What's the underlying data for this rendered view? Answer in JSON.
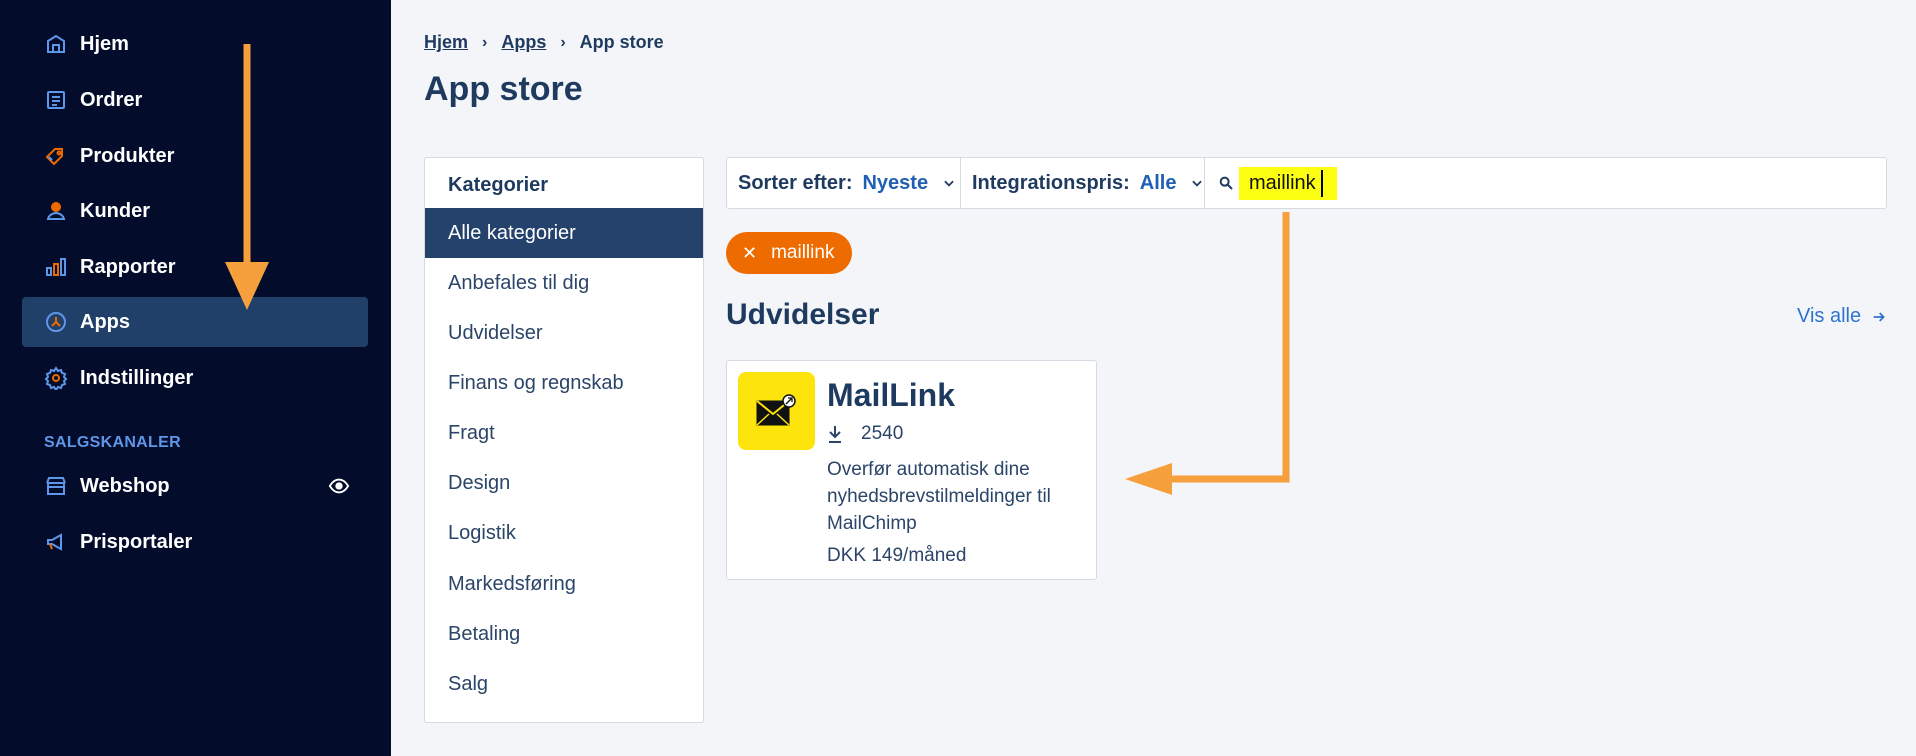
{
  "sidebar": {
    "items": [
      {
        "label": "Hjem",
        "icon": "home-icon"
      },
      {
        "label": "Ordrer",
        "icon": "orders-icon"
      },
      {
        "label": "Produkter",
        "icon": "tag-icon"
      },
      {
        "label": "Kunder",
        "icon": "user-icon"
      },
      {
        "label": "Rapporter",
        "icon": "bar-chart-icon"
      },
      {
        "label": "Apps",
        "icon": "apps-icon"
      },
      {
        "label": "Indstillinger",
        "icon": "gear-icon"
      }
    ],
    "active": "Apps",
    "sales_channels_title": "SALGSKANALER",
    "channels": [
      {
        "label": "Webshop",
        "icon": "store-icon"
      },
      {
        "label": "Prisportaler",
        "icon": "megaphone-icon"
      }
    ]
  },
  "breadcrumb": {
    "items": [
      "Hjem",
      "Apps",
      "App store"
    ]
  },
  "page_title": "App store",
  "categories": {
    "heading": "Kategorier",
    "items": [
      "Alle kategorier",
      "Anbefales til dig",
      "Udvidelser",
      "Finans og regnskab",
      "Fragt",
      "Design",
      "Logistik",
      "Markedsføring",
      "Betaling",
      "Salg"
    ],
    "active": "Alle kategorier"
  },
  "filters": {
    "sort_label": "Sorter efter:",
    "sort_value": "Nyeste",
    "price_label": "Integrationspris:",
    "price_value": "Alle",
    "search_value": "maillink"
  },
  "chip": {
    "label": "maillink"
  },
  "results": {
    "heading": "Udvidelser",
    "view_all": "Vis alle",
    "cards": [
      {
        "title": "MailLink",
        "downloads": "2540",
        "description": "Overfør automatisk dine nyhedsbrevstilmeldinger til MailChimp",
        "price": "DKK 149/måned"
      }
    ]
  },
  "colors": {
    "sidebar_bg": "#040c2c",
    "active_bg": "#203f69",
    "accent_orange": "#ee6b00",
    "highlight_yellow": "#fcff11",
    "annotation_arrow": "#f5a03c"
  }
}
